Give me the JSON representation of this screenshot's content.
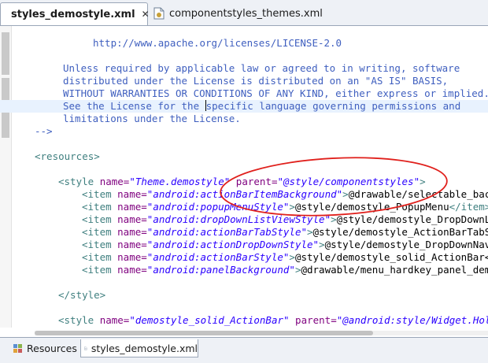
{
  "tabs": [
    {
      "label": "styles_demostyle.xml",
      "active": true
    },
    {
      "label": "componentstyles_themes.xml",
      "active": false
    }
  ],
  "close_glyph": "✕",
  "code": {
    "license_url": "http://www.apache.org/licenses/LICENSE-2.0",
    "license_lines": [
      "Unless required by applicable law or agreed to in writing, software",
      "distributed under the License is distributed on an \"AS IS\" BASIS,",
      "WITHOUT WARRANTIES OR CONDITIONS OF ANY KIND, either express or implied.",
      "See the License for the ",
      "specific language governing permissions and",
      "limitations under the License."
    ],
    "comment_end": "-->",
    "resources_open": "<resources>",
    "style_open": {
      "tag": "<style ",
      "name_attr": "name=",
      "name_val": "\"Theme.demostyle\"",
      "parent_attr": " parent=",
      "parent_val": "\"@style/componentstyles\"",
      "close": ">"
    },
    "items": [
      {
        "name": "\"android:actionBarItemBackground\"",
        "value": "@drawable/selectable_bac"
      },
      {
        "name": "\"android:popupMenuStyle\"",
        "value": "@style/demostyle_PopupMenu",
        "end": "</item>"
      },
      {
        "name": "\"android:dropDownListViewStyle\"",
        "value": "@style/demostyle_DropDownL"
      },
      {
        "name": "\"android:actionBarTabStyle\"",
        "value": "@style/demostyle_ActionBarTabS"
      },
      {
        "name": "\"android:actionDropDownStyle\"",
        "value": "@style/demostyle_DropDownNav"
      },
      {
        "name": "\"android:actionBarStyle\"",
        "value": "@style/demostyle_solid_ActionBar<"
      },
      {
        "name": "\"android:panelBackground\"",
        "value": "@drawable/menu_hardkey_panel_dem"
      }
    ],
    "item_open": "<item ",
    "item_name_attr": "name=",
    "item_gt": ">",
    "style_close": "</style>",
    "style2": {
      "tag": "<style ",
      "name_attr": "name=",
      "name_val": "\"demostyle_solid_ActionBar\"",
      "parent_attr": " parent=",
      "parent_val": "\"@android:style/Widget.Hol"
    }
  },
  "bottom_tabs": [
    {
      "label": "Resources",
      "active": false
    },
    {
      "label": "styles_demostyle.xml",
      "active": true
    }
  ],
  "colors": {
    "comment": "#3f5fbf",
    "tag": "#3f7f7f",
    "attribute": "#7f007f",
    "value": "#2a00ff",
    "annotation": "#e0201c"
  }
}
